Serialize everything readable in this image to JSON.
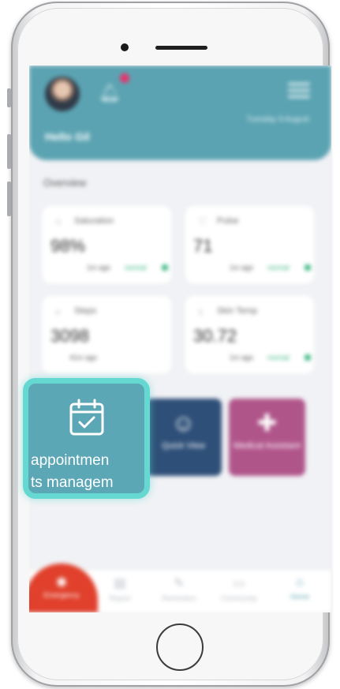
{
  "header": {
    "greeting": "Hello Gil",
    "date": "Tuesday 9 August"
  },
  "overview": {
    "title": "Overview",
    "cards": [
      {
        "label": "Saturation",
        "value": "98%",
        "time": "1m ago",
        "status": "normal",
        "icon": "saturation-icon"
      },
      {
        "label": "Pulse",
        "value": "71",
        "time": "1m ago",
        "status": "normal",
        "icon": "heart-icon"
      },
      {
        "label": "Steps",
        "value": "3098",
        "time": "41m ago",
        "status": "",
        "icon": "steps-icon"
      },
      {
        "label": "Skin Temp",
        "value": "30.72",
        "time": "1m ago",
        "status": "normal",
        "icon": "thermometer-icon"
      }
    ]
  },
  "tiles": [
    {
      "label": "Quick View",
      "color": "#2e4f78",
      "icon": "user-check-icon"
    },
    {
      "label": "Medical Assistant",
      "color": "#b0558a",
      "icon": "medical-cross-icon"
    }
  ],
  "focus_tile": {
    "label_line1": "appointmen",
    "label_line2": "ts managem",
    "icon": "calendar-check-icon",
    "color": "#5ca7b5",
    "highlight_color": "#66d8d2"
  },
  "tabbar": {
    "fab_label": "Emergency",
    "tabs": [
      {
        "label": "Report",
        "icon": "report-icon"
      },
      {
        "label": "Reminders",
        "icon": "pencil-icon"
      },
      {
        "label": "Community",
        "icon": "chat-icon"
      },
      {
        "label": "Home",
        "icon": "home-icon",
        "active": true
      }
    ]
  }
}
